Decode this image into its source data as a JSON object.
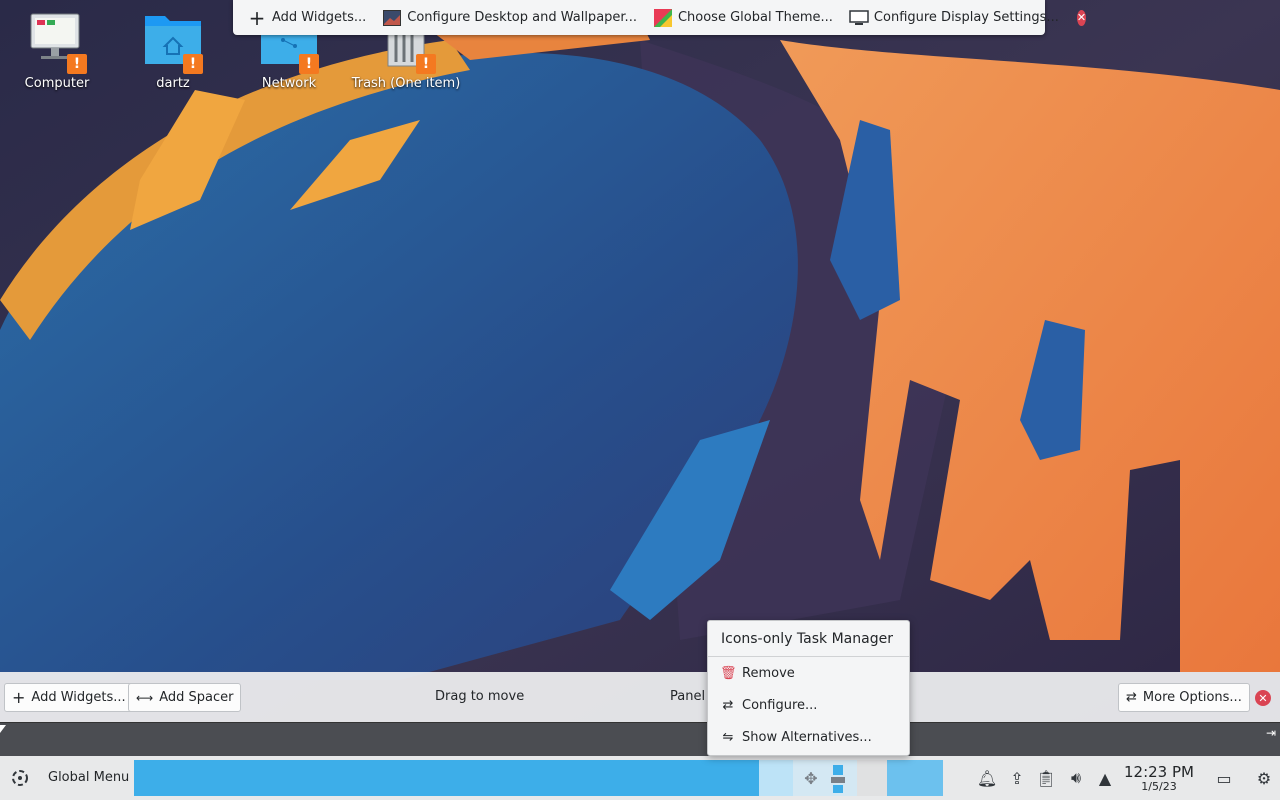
{
  "desktop_icons": [
    {
      "name": "computer",
      "label": "Computer"
    },
    {
      "name": "home-folder",
      "label": "dartz"
    },
    {
      "name": "network",
      "label": "Network"
    },
    {
      "name": "trash",
      "label": "Trash (One item)"
    }
  ],
  "top_toolbar": {
    "add_widgets": "Add Widgets...",
    "configure_desktop": "Configure Desktop and Wallpaper...",
    "global_theme": "Choose Global Theme...",
    "display_settings": "Configure Display Settings..."
  },
  "edit_bar": {
    "add_widgets": "Add Widgets...",
    "add_spacer": "Add Spacer",
    "drag_to_move": "Drag to move",
    "panel_label": "Panel",
    "more_options": "More Options..."
  },
  "context_menu": {
    "title": "Icons-only Task Manager",
    "remove": "Remove",
    "configure": "Configure...",
    "show_alternatives": "Show Alternatives..."
  },
  "taskbar": {
    "global_menu": "Global Menu",
    "time": "12:23 PM",
    "date": "1/5/23"
  },
  "colors": {
    "accent": "#3daee9",
    "close": "#da4453",
    "warning": "#f47920"
  }
}
